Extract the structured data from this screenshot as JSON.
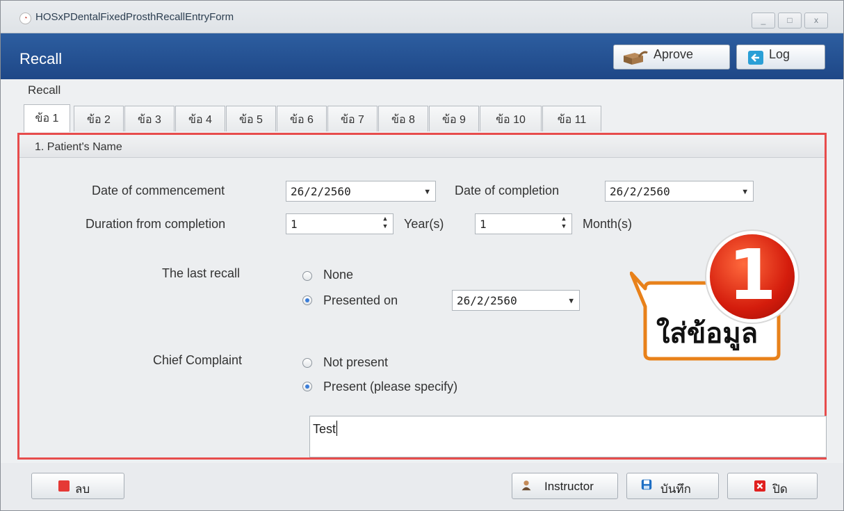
{
  "window": {
    "title": "HOSxPDentalFixedProsthRecallEntryForm",
    "minimize": "_",
    "maximize": "□",
    "close": "x"
  },
  "header": {
    "title": "Recall",
    "approve_label": "Aprove",
    "log_label": "Log"
  },
  "section_label": "Recall",
  "tabs": [
    "ข้อ 1",
    "ข้อ 2",
    "ข้อ 3",
    "ข้อ 4",
    "ข้อ 5",
    "ข้อ 6",
    "ข้อ 7",
    "ข้อ 8",
    "ข้อ 9",
    "ข้อ 10",
    "ข้อ 11"
  ],
  "active_tab": "ข้อ 1",
  "group": {
    "title": "1. Patient's Name"
  },
  "form": {
    "date_commencement_label": "Date of commencement",
    "date_commencement_value": "26/2/2560",
    "date_completion_label": "Date of completion",
    "date_completion_value": "26/2/2560",
    "duration_label": "Duration from completion",
    "duration_years_value": "1",
    "years_unit": "Year(s)",
    "duration_months_value": "1",
    "months_unit": "Month(s)",
    "last_recall_label": "The last recall",
    "last_recall_none": "None",
    "last_recall_presented": "Presented on",
    "last_recall_date": "26/2/2560",
    "last_recall_selected": "Presented on",
    "chief_complaint_label": "Chief Complaint",
    "chief_not_present": "Not present",
    "chief_present": "Present (please specify)",
    "chief_selected": "Present (please specify)",
    "chief_text": "Test"
  },
  "callout": {
    "number": "1",
    "text": "ใส่ข้อมูล",
    "color": "#e8811a"
  },
  "footer": {
    "delete_label": "ลบ",
    "instructor_label": "Instructor",
    "save_label": "บันทึก",
    "close_label": "ปิด"
  },
  "colors": {
    "header_blue": "#1e4787",
    "highlight_red": "#e74c4c",
    "radio_blue": "#3b7dd8"
  },
  "icons": [
    "app-logo-icon",
    "box-approve-icon",
    "log-out-icon",
    "delete-icon",
    "user-icon",
    "save-disk-icon",
    "close-x-icon"
  ]
}
